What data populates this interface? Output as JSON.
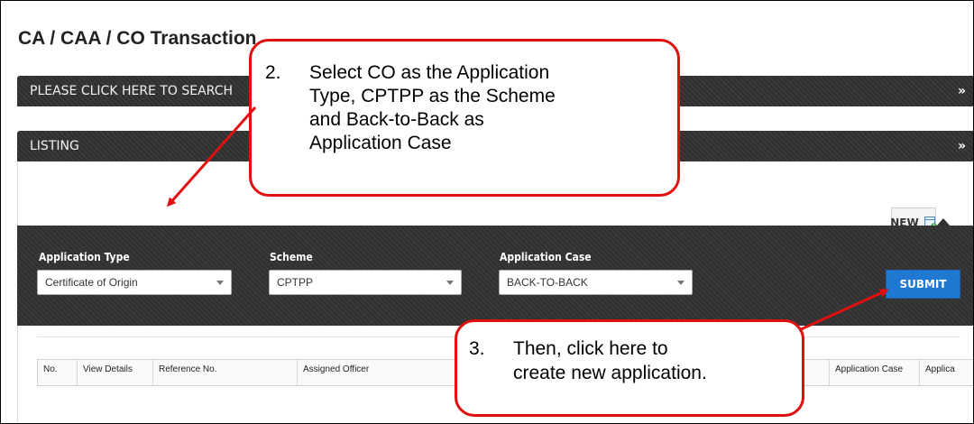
{
  "page": {
    "title": "CA / CAA / CO Transaction"
  },
  "search_bar": {
    "label": "PLEASE CLICK HERE TO SEARCH",
    "chevron_icon": "double-chevron-down-icon"
  },
  "listing_bar": {
    "label": "LISTING",
    "chevron_icon": "double-chevron-down-icon"
  },
  "new_button": {
    "label": "NEW",
    "icon": "new-document-icon"
  },
  "form": {
    "application_type": {
      "label": "Application Type",
      "value": "Certificate of Origin"
    },
    "scheme": {
      "label": "Scheme",
      "value": "CPTPP"
    },
    "application_case": {
      "label": "Application Case",
      "value": "BACK-TO-BACK"
    },
    "submit_label": "SUBMIT"
  },
  "table": {
    "columns": [
      "No.",
      "View Details",
      "Reference No.",
      "Assigned Officer",
      "Application Case",
      "Applica"
    ]
  },
  "callouts": [
    {
      "number": "2.",
      "lines": [
        "Select CO as the Application",
        "Type, CPTPP as the Scheme",
        "and Back-to-Back as",
        "Application Case"
      ]
    },
    {
      "number": "3.",
      "lines": [
        "Then, click here to",
        "create new application."
      ]
    }
  ],
  "colors": {
    "callout_border": "#e01010",
    "submit_bg": "#1f78d1",
    "dark_panel": "#303030"
  }
}
